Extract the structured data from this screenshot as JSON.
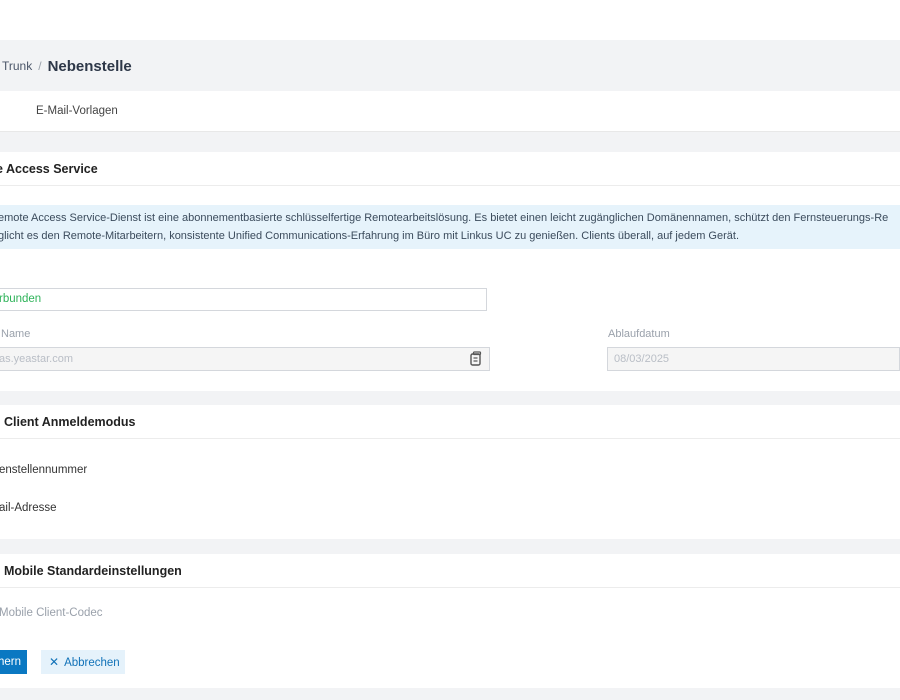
{
  "breadcrumb": {
    "parent": "Trunk",
    "separator": "/",
    "current": "Nebenstelle"
  },
  "subnav": {
    "item": "E-Mail-Vorlagen"
  },
  "remote_access": {
    "title": "e Access Service",
    "info_line1": "emote Access Service-Dienst ist eine abonnementbasierte schlüsselfertige Remotearbeitslösung. Es bietet einen leicht zugänglichen Domänennamen, schützt den Fernsteuerungs-Re",
    "info_line2": "glicht es den Remote-Mitarbeitern, konsistente Unified Communications-Erfahrung im Büro mit Linkus UC zu genießen. Clients überall, auf jedem Gerät.",
    "status_value": "rbunden",
    "name_label": "Name",
    "name_value": "as.yeastar.com",
    "expiry_label": "Ablaufdatum",
    "expiry_value": "08/03/2025"
  },
  "login_mode": {
    "title": "Client Anmeldemodus",
    "option1": "enstellennummer",
    "option2": "ail-Adresse"
  },
  "mobile_defaults": {
    "title": "Mobile Standardeinstellungen",
    "codec_label": "Mobile Client-Codec"
  },
  "actions": {
    "save_label": "hern",
    "cancel_label": "Abbrechen"
  },
  "colors": {
    "primary": "#0a78c2",
    "connected": "#2fb35a",
    "info_bg": "#e6f3fb"
  }
}
